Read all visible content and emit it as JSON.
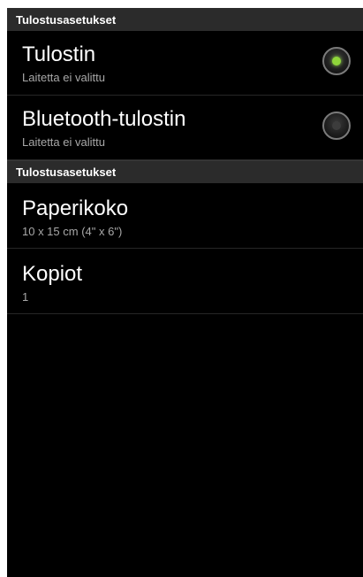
{
  "header_top": {
    "label": "Tulostusasetukset"
  },
  "printers": [
    {
      "title": "Tulostin",
      "subtitle": "Laitetta ei valittu",
      "selected": true
    },
    {
      "title": "Bluetooth-tulostin",
      "subtitle": "Laitetta ei valittu",
      "selected": false
    }
  ],
  "header_settings": {
    "label": "Tulostusasetukset"
  },
  "settings": [
    {
      "title": "Paperikoko",
      "value": "10 x 15 cm (4\" x 6\")"
    },
    {
      "title": "Kopiot",
      "value": "1"
    }
  ],
  "colors": {
    "background": "#000000",
    "section_header": "#2b2b2b",
    "radio_selected": "#8fd63a"
  },
  "icons": {
    "radio_selected": "radio-on-icon",
    "radio_unselected": "radio-off-icon"
  }
}
